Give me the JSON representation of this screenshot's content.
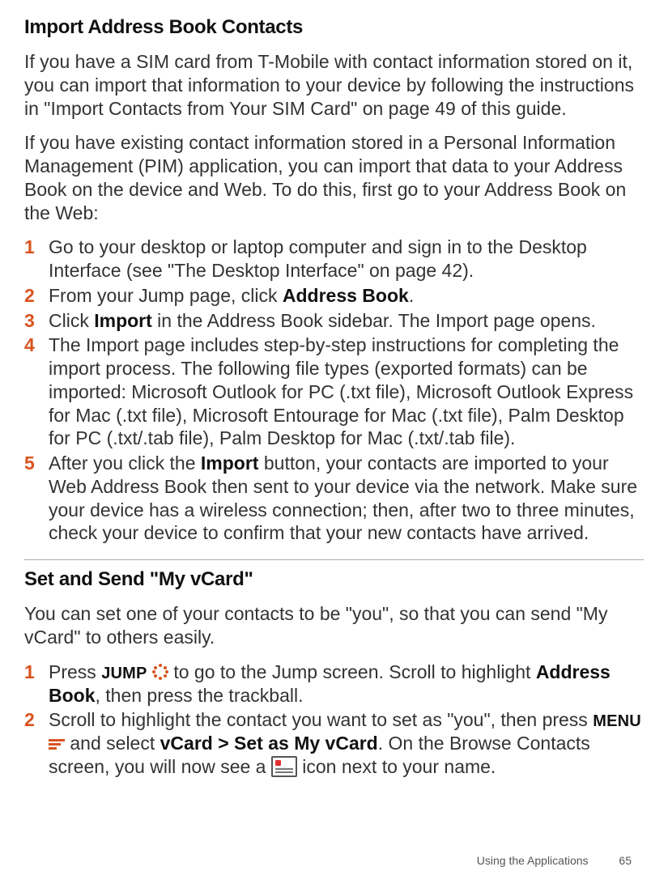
{
  "section1": {
    "heading": "Import Address Book Contacts",
    "para1": "If you have a SIM card from T-Mobile with contact information stored on it, you can import that information to your device by following the instructions in \"Import Contacts from Your SIM Card\" on page 49 of this guide.",
    "para2": "If you have existing contact information stored in a Personal Information Management (PIM) application, you can import that data to your Address Book on the device and Web. To do this, first go to your Address Book on the Web:",
    "steps": {
      "s1a": "Go to your desktop or laptop computer and sign in to the Desktop Interface (see \"The Desktop Interface\" on page 42).",
      "s2a": "From your Jump page, click ",
      "s2b": "Address Book",
      "s2c": ".",
      "s3a": "Click ",
      "s3b": "Import",
      "s3c": " in the Address Book sidebar. The Import page opens.",
      "s4a": "The Import page includes step-by-step instructions for completing the import process. The following file types (exported formats) can be imported: Microsoft Outlook for PC (.txt file), Microsoft Outlook Express for Mac (.txt file), Microsoft Entourage for Mac (.txt file), Palm Desktop for PC (.txt/.tab file), Palm Desktop for Mac (.txt/.tab file).",
      "s5a": "After you click the ",
      "s5b": "Import",
      "s5c": " button, your contacts are imported to your Web Address Book then sent to your device via the network. Make sure your device has a wireless connection; then, after two to three minutes, check your device to confirm that your new contacts have arrived."
    }
  },
  "section2": {
    "heading": "Set and Send \"My vCard\"",
    "para1": "You can set one of your contacts to be \"you\", so that you can send \"My vCard\" to others easily.",
    "steps": {
      "s1a": "Press ",
      "s1b": "JUMP",
      "s1c": " to go to the Jump screen. Scroll to highlight ",
      "s1d": "Address Book",
      "s1e": ", then press the trackball.",
      "s2a": "Scroll to highlight the contact you want to set as \"you\", then press ",
      "s2b": "MENU",
      "s2c": " and select ",
      "s2d": "vCard > Set as My vCard",
      "s2e": ". On the Browse Contacts screen, you will now see a ",
      "s2f": " icon next to your name."
    }
  },
  "footer": {
    "chapter": "Using the Applications",
    "page": "65"
  },
  "numbers": {
    "n1": "1",
    "n2": "2",
    "n3": "3",
    "n4": "4",
    "n5": "5"
  }
}
